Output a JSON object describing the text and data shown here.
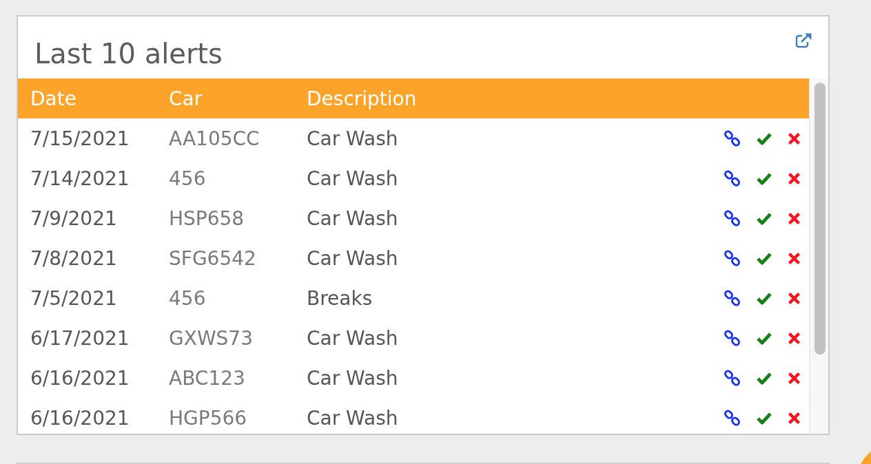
{
  "panel": {
    "title": "Last 10 alerts"
  },
  "table": {
    "columns": [
      "Date",
      "Car",
      "Description"
    ],
    "rows": [
      {
        "date": "7/15/2021",
        "car": "AA105CC",
        "description": "Car Wash"
      },
      {
        "date": "7/14/2021",
        "car": "456",
        "description": "Car Wash"
      },
      {
        "date": "7/9/2021",
        "car": "HSP658",
        "description": "Car Wash"
      },
      {
        "date": "7/8/2021",
        "car": "SFG6542",
        "description": "Car Wash"
      },
      {
        "date": "7/5/2021",
        "car": "456",
        "description": "Breaks"
      },
      {
        "date": "6/17/2021",
        "car": "GXWS73",
        "description": "Car Wash"
      },
      {
        "date": "6/16/2021",
        "car": "ABC123",
        "description": "Car Wash"
      },
      {
        "date": "6/16/2021",
        "car": "HGP566",
        "description": "Car Wash"
      }
    ]
  }
}
